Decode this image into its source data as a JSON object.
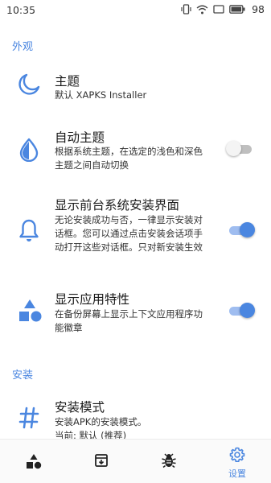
{
  "status_bar": {
    "time": "10:35",
    "battery": "98"
  },
  "sections": {
    "appearance": "外观",
    "install": "安装"
  },
  "prefs": {
    "theme": {
      "title": "主题",
      "summary": "默认 XAPKS Installer"
    },
    "auto_theme": {
      "title": "自动主题",
      "summary": "根据系统主题，在选定的浅色和深色主题之间自动切换",
      "enabled": false
    },
    "show_install_ui": {
      "title": "显示前台系统安装界面",
      "summary": "无论安装成功与否，一律显示安装对话框。您可以通过点击安装会话项手动打开这些对话框。只对新安装生效",
      "enabled": true
    },
    "app_features": {
      "title": "显示应用特性",
      "summary": "在备份屏幕上显示上下文应用程序功能徽章",
      "enabled": true
    },
    "install_mode": {
      "title": "安装模式",
      "summary_line1": "安装APK的安装模式。",
      "summary_line2": "当前: 默认 (推荐)"
    }
  },
  "bottom_nav": {
    "settings_label": "设置"
  },
  "colors": {
    "accent": "#4a86e0"
  }
}
